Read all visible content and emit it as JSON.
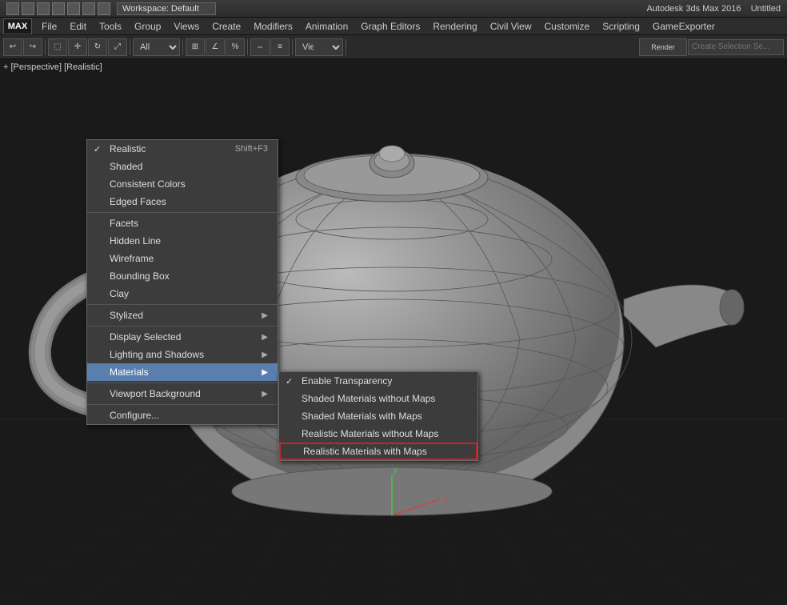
{
  "app": {
    "title": "Autodesk 3ds Max 2016",
    "filename": "Untitled",
    "workspace": "Workspace: Default"
  },
  "titlebar": {
    "title_text": "Autodesk 3ds Max 2016",
    "filename": "Untitled"
  },
  "menubar": {
    "items": [
      {
        "label": "File",
        "id": "file"
      },
      {
        "label": "Edit",
        "id": "edit"
      },
      {
        "label": "Tools",
        "id": "tools"
      },
      {
        "label": "Group",
        "id": "group"
      },
      {
        "label": "Views",
        "id": "views"
      },
      {
        "label": "Create",
        "id": "create"
      },
      {
        "label": "Modifiers",
        "id": "modifiers"
      },
      {
        "label": "Animation",
        "id": "animation"
      },
      {
        "label": "Graph Editors",
        "id": "graph-editors"
      },
      {
        "label": "Rendering",
        "id": "rendering"
      },
      {
        "label": "Civil View",
        "id": "civil-view"
      },
      {
        "label": "Customize",
        "id": "customize"
      },
      {
        "label": "Scripting",
        "id": "scripting"
      },
      {
        "label": "GameExporter",
        "id": "gameexporter"
      }
    ]
  },
  "viewport": {
    "label": "+ [Perspective] [Realistic]"
  },
  "context_menu": {
    "items": [
      {
        "label": "Realistic",
        "shortcut": "Shift+F3",
        "checked": true,
        "has_arrow": false,
        "id": "realistic"
      },
      {
        "label": "Shaded",
        "shortcut": "",
        "checked": false,
        "has_arrow": false,
        "id": "shaded"
      },
      {
        "label": "Consistent Colors",
        "shortcut": "",
        "checked": false,
        "has_arrow": false,
        "id": "consistent-colors"
      },
      {
        "label": "Edged Faces",
        "shortcut": "",
        "checked": false,
        "has_arrow": false,
        "id": "edged-faces"
      },
      {
        "label": "sep1",
        "type": "separator"
      },
      {
        "label": "Facets",
        "shortcut": "",
        "checked": false,
        "has_arrow": false,
        "id": "facets"
      },
      {
        "label": "Hidden Line",
        "shortcut": "",
        "checked": false,
        "has_arrow": false,
        "id": "hidden-line"
      },
      {
        "label": "Wireframe",
        "shortcut": "",
        "checked": false,
        "has_arrow": false,
        "id": "wireframe"
      },
      {
        "label": "Bounding Box",
        "shortcut": "",
        "checked": false,
        "has_arrow": false,
        "id": "bounding-box"
      },
      {
        "label": "Clay",
        "shortcut": "",
        "checked": false,
        "has_arrow": false,
        "id": "clay"
      },
      {
        "label": "sep2",
        "type": "separator"
      },
      {
        "label": "Stylized",
        "shortcut": "",
        "checked": false,
        "has_arrow": true,
        "id": "stylized"
      },
      {
        "label": "sep3",
        "type": "separator"
      },
      {
        "label": "Display Selected",
        "shortcut": "",
        "checked": false,
        "has_arrow": true,
        "id": "display-selected"
      },
      {
        "label": "Lighting and Shadows",
        "shortcut": "",
        "checked": false,
        "has_arrow": true,
        "id": "lighting-shadows"
      },
      {
        "label": "Materials",
        "shortcut": "",
        "checked": false,
        "has_arrow": true,
        "id": "materials",
        "highlighted": true
      },
      {
        "label": "sep4",
        "type": "separator"
      },
      {
        "label": "Viewport Background",
        "shortcut": "",
        "checked": false,
        "has_arrow": true,
        "id": "viewport-bg"
      },
      {
        "label": "sep5",
        "type": "separator"
      },
      {
        "label": "Configure...",
        "shortcut": "",
        "checked": false,
        "has_arrow": false,
        "id": "configure"
      }
    ]
  },
  "submenu_materials": {
    "items": [
      {
        "label": "Enable Transparency",
        "checked": true,
        "id": "enable-transparency",
        "selected_border": false
      },
      {
        "label": "Shaded Materials without Maps",
        "checked": false,
        "id": "shaded-no-maps",
        "selected_border": false
      },
      {
        "label": "Shaded Materials with Maps",
        "checked": false,
        "id": "shaded-with-maps",
        "selected_border": false
      },
      {
        "label": "Realistic Materials without Maps",
        "checked": false,
        "id": "realistic-no-maps",
        "selected_border": false
      },
      {
        "label": "Realistic Materials with Maps",
        "checked": false,
        "id": "realistic-with-maps",
        "selected_border": true
      }
    ]
  },
  "colors": {
    "accent_blue": "#5a7faf",
    "border_red": "#cc2222",
    "bg_dark": "#1e1e1e",
    "menu_bg": "#3c3c3c"
  }
}
